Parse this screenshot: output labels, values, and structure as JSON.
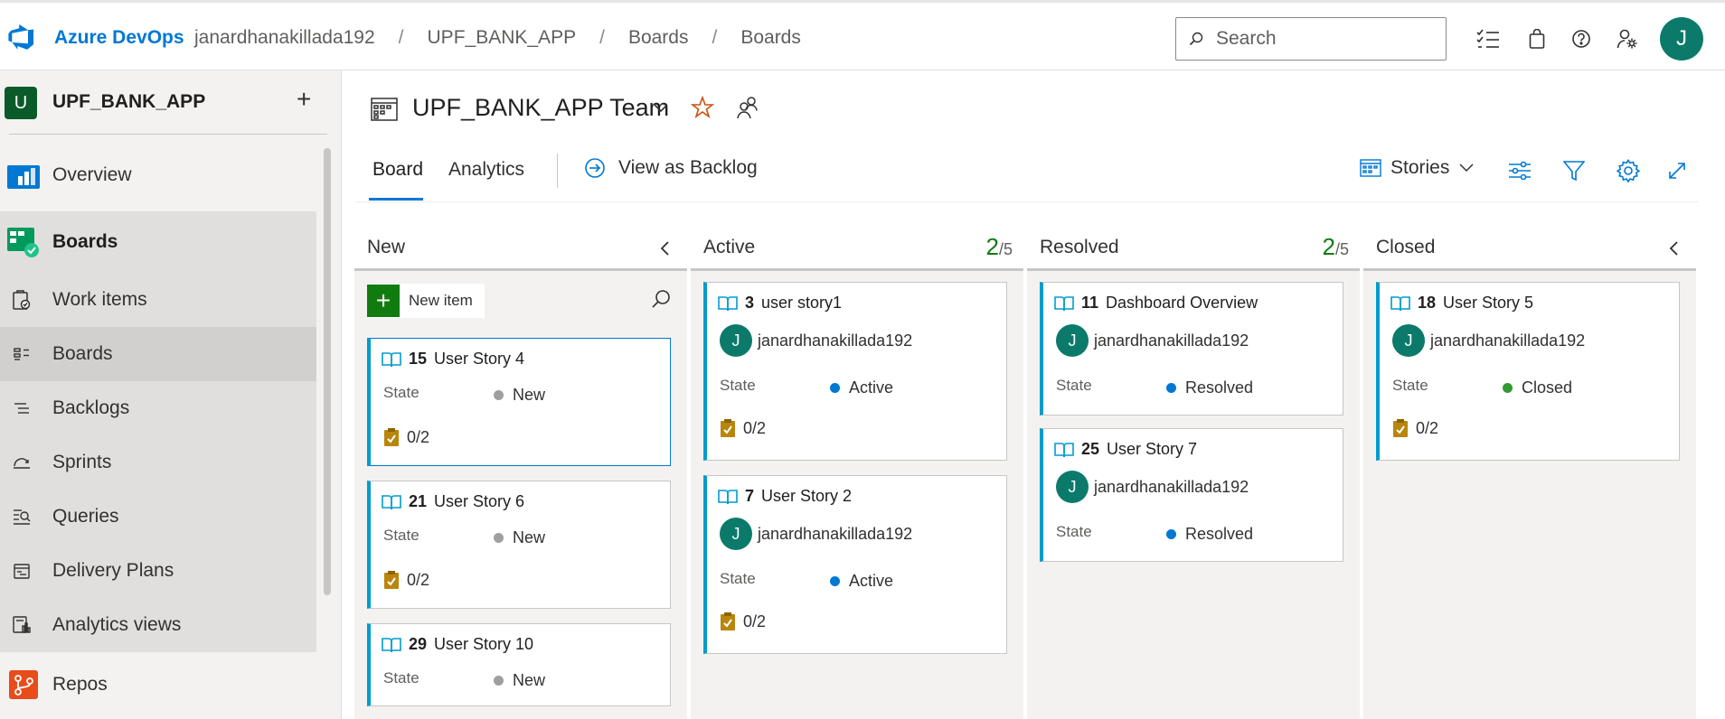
{
  "header": {
    "brand": "Azure DevOps",
    "breadcrumbs": [
      "janardhanakillada192",
      "UPF_BANK_APP",
      "Boards",
      "Boards"
    ],
    "search_placeholder": "Search",
    "user_initial": "J",
    "icons": [
      "task-list-icon",
      "shopping-bag-icon",
      "help-icon",
      "user-settings-icon"
    ]
  },
  "sidebar": {
    "project_initial": "U",
    "project_name": "UPF_BANK_APP",
    "add_label": "+",
    "items": [
      {
        "label": "Overview",
        "icon": "overview-icon"
      },
      {
        "label": "Boards",
        "icon": "boards-hub-icon"
      },
      {
        "label": "Work items",
        "icon": "work-items-icon"
      },
      {
        "label": "Boards",
        "icon": "boards-icon"
      },
      {
        "label": "Backlogs",
        "icon": "backlogs-icon"
      },
      {
        "label": "Sprints",
        "icon": "sprints-icon"
      },
      {
        "label": "Queries",
        "icon": "queries-icon"
      },
      {
        "label": "Delivery Plans",
        "icon": "delivery-plans-icon"
      },
      {
        "label": "Analytics views",
        "icon": "analytics-views-icon"
      },
      {
        "label": "Repos",
        "icon": "repos-icon"
      }
    ]
  },
  "page": {
    "team_name": "UPF_BANK_APP Team",
    "tabs": [
      "Board",
      "Analytics"
    ],
    "view_as_backlog": "View as Backlog",
    "backlog_level": "Stories"
  },
  "colors": {
    "accent": "#0078d4",
    "story_bar": "#009ccc",
    "new_state": "#a19f9d",
    "active_state": "#0078d4",
    "resolved_state": "#0078d4",
    "closed_state": "#339933",
    "wip_count": "#107c10"
  },
  "board": {
    "new_item_label": "New item",
    "state_label": "State",
    "columns": [
      {
        "title": "New",
        "wip": null,
        "cards": [
          {
            "id": "15",
            "title": "User Story 4",
            "state": "New",
            "tasks": "0/2"
          },
          {
            "id": "21",
            "title": "User Story 6",
            "state": "New",
            "tasks": "0/2"
          },
          {
            "id": "29",
            "title": "User Story 10",
            "state": "New",
            "tasks": null
          }
        ]
      },
      {
        "title": "Active",
        "wip": {
          "count": "2",
          "limit": "/5"
        },
        "cards": [
          {
            "id": "3",
            "title": "user story1",
            "assignee": "janardhanakillada192",
            "initial": "J",
            "state": "Active",
            "tasks": "0/2"
          },
          {
            "id": "7",
            "title": "User Story 2",
            "assignee": "janardhanakillada192",
            "initial": "J",
            "state": "Active",
            "tasks": "0/2"
          }
        ]
      },
      {
        "title": "Resolved",
        "wip": {
          "count": "2",
          "limit": "/5"
        },
        "cards": [
          {
            "id": "11",
            "title": "Dashboard Overview",
            "assignee": "janardhanakillada192",
            "initial": "J",
            "state": "Resolved"
          },
          {
            "id": "25",
            "title": "User Story 7",
            "assignee": "janardhanakillada192",
            "initial": "J",
            "state": "Resolved"
          }
        ]
      },
      {
        "title": "Closed",
        "wip": null,
        "cards": [
          {
            "id": "18",
            "title": "User Story 5",
            "assignee": "janardhanakillada192",
            "initial": "J",
            "state": "Closed",
            "tasks": "0/2"
          }
        ]
      }
    ]
  }
}
